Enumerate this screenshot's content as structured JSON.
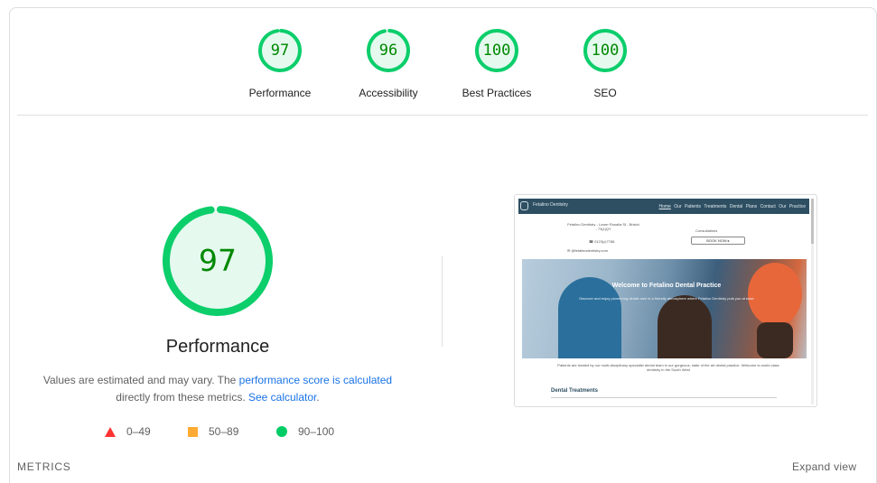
{
  "colors": {
    "pass": "#0cce6b",
    "pass_fill": "#e5f9ef",
    "pass_text": "#008800",
    "average": "#ffaa33",
    "fail": "#ff3333",
    "link": "#1a73e8"
  },
  "gauges": [
    {
      "score": 97,
      "label": "Performance",
      "score_text": "97"
    },
    {
      "score": 96,
      "label": "Accessibility",
      "score_text": "96"
    },
    {
      "score": 100,
      "label": "Best Practices",
      "score_text": "100"
    },
    {
      "score": 100,
      "label": "SEO",
      "score_text": "100"
    }
  ],
  "main": {
    "score": 97,
    "score_text": "97",
    "title": "Performance",
    "desc_prefix": "Values are estimated and may vary. The ",
    "desc_link1": "performance score is calculated",
    "desc_mid": "directly from these metrics. ",
    "desc_link2": "See calculator",
    "desc_suffix": "."
  },
  "legend": [
    {
      "icon": "triangle-icon",
      "range": "0–49"
    },
    {
      "icon": "square-icon",
      "range": "50–89"
    },
    {
      "icon": "circle-icon",
      "range": "90–100"
    }
  ],
  "thumbnail": {
    "brand": "Fetalino Dentistry",
    "nav_links": [
      "Home",
      "Our Patients",
      "Treatments",
      "Dental Plans",
      "Contact",
      "Our Practice"
    ],
    "address": "Fetalino Dentistry - Lower Rosalia St - Bristol - 73(ε)QY",
    "phone": "☎ 0123(ε)7788",
    "email": "✉ @fetalinodentistry.com",
    "consult_label": "Consultations",
    "button_label": "BOOK NOW ▸",
    "hero_title": "Welcome to Fetalino Dental Practice",
    "hero_sub": "Discover and enjoy pioneering dental care in a friendly atmosphere where Fetalino Dentistry puts you at ease",
    "body_text": "Patients are treated by our multi-disciplinary specialist dental team in our gorgeous, state of the art dental practice. Welcome to world class dentistry in the South West",
    "section_heading": "Dental Treatments"
  },
  "footer": {
    "metrics_label": "METRICS",
    "expand_label": "Expand view"
  }
}
